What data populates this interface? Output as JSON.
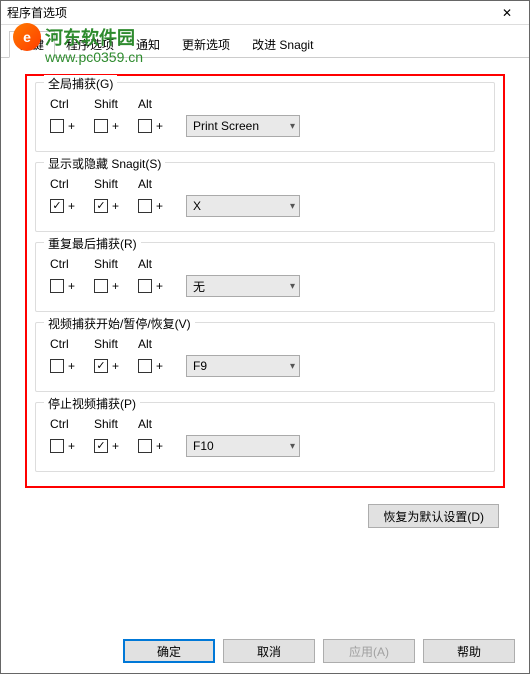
{
  "window": {
    "title": "程序首选项",
    "close_glyph": "✕"
  },
  "watermark": {
    "logo_letter": "e",
    "text": "河东软件园",
    "url": "www.pc0359.cn"
  },
  "tabs": {
    "items": [
      {
        "label": "热键",
        "active": true
      },
      {
        "label": "程序选项",
        "active": false
      },
      {
        "label": "通知",
        "active": false
      },
      {
        "label": "更新选项",
        "active": false
      },
      {
        "label": "改进 Snagit",
        "active": false
      }
    ]
  },
  "modifiers": {
    "ctrl": "Ctrl",
    "shift": "Shift",
    "alt": "Alt",
    "plus": "+"
  },
  "hotkeys": [
    {
      "title": "全局捕获(G)",
      "ctrl": false,
      "shift": false,
      "alt": false,
      "key": "Print Screen"
    },
    {
      "title": "显示或隐藏 Snagit(S)",
      "ctrl": true,
      "shift": true,
      "alt": false,
      "key": "X"
    },
    {
      "title": "重复最后捕获(R)",
      "ctrl": false,
      "shift": false,
      "alt": false,
      "key": "无"
    },
    {
      "title": "视频捕获开始/暂停/恢复(V)",
      "ctrl": false,
      "shift": true,
      "alt": false,
      "key": "F9"
    },
    {
      "title": "停止视频捕获(P)",
      "ctrl": false,
      "shift": true,
      "alt": false,
      "key": "F10"
    }
  ],
  "buttons": {
    "restore": "恢复为默认设置(D)",
    "ok": "确定",
    "cancel": "取消",
    "apply": "应用(A)",
    "help": "帮助"
  }
}
